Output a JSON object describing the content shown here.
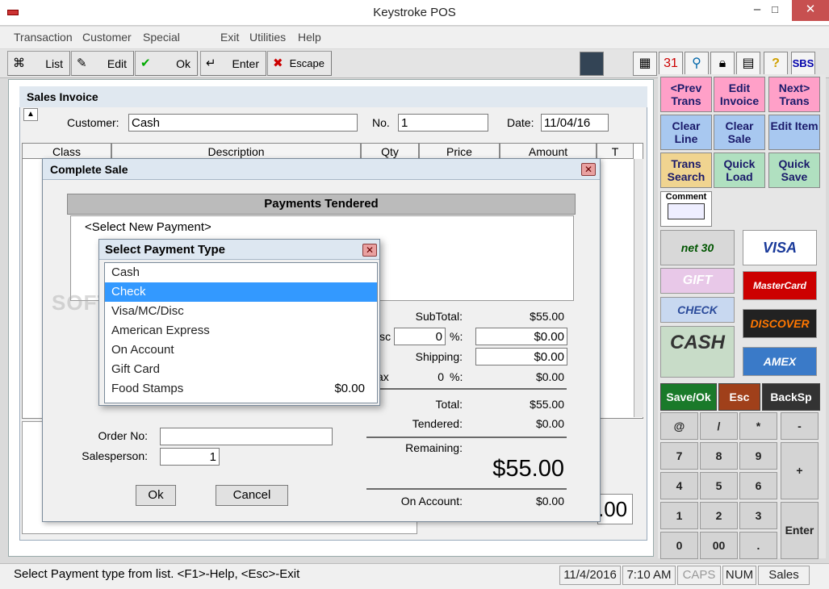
{
  "window": {
    "title": "Keystroke POS",
    "minimize": "–",
    "maximize": "□",
    "close": "✕"
  },
  "menu": [
    "Transaction",
    "Customer",
    "Special",
    "Exit",
    "Utilities",
    "Help"
  ],
  "toolbar": {
    "list": "List",
    "edit": "Edit",
    "ok": "Ok",
    "enter": "Enter",
    "escape": "Escape"
  },
  "invoice": {
    "title": "Sales Invoice",
    "customer_label": "Customer:",
    "customer_value": "Cash",
    "no_label": "No.",
    "no_value": "1",
    "date_label": "Date:",
    "date_value": "11/04/16",
    "total_fragment": ".00"
  },
  "columns": [
    "Class",
    "Description",
    "Qty",
    "Price",
    "Amount",
    "T"
  ],
  "complete_sale": {
    "title": "Complete Sale",
    "payments_header": "Payments Tendered",
    "select_new_payment": "<Select New Payment>",
    "subtotal_label": "SubTotal:",
    "subtotal_value": "$55.00",
    "disc_label": "isc",
    "disc_pct": "0",
    "pct_sign": "%:",
    "disc_amount": "$0.00",
    "shipping_label": "Shipping:",
    "shipping_value": "$0.00",
    "tax_label": "ax",
    "tax_pct": "0",
    "tax_value": "$0.00",
    "total_label": "Total:",
    "total_value": "$55.00",
    "tendered_label": "Tendered:",
    "tendered_value": "$0.00",
    "remaining_label": "Remaining:",
    "remaining_value": "$55.00",
    "on_account_label": "On Account:",
    "on_account_value": "$0.00",
    "order_no_label": "Order No:",
    "order_no_value": "",
    "salesperson_label": "Salesperson:",
    "salesperson_value": "1",
    "ok_label": "Ok",
    "cancel_label": "Cancel"
  },
  "payment_popup": {
    "title": "Select Payment Type",
    "selected_index": 1,
    "items": [
      {
        "label": "Cash",
        "amount": ""
      },
      {
        "label": "Check",
        "amount": ""
      },
      {
        "label": "Visa/MC/Disc",
        "amount": ""
      },
      {
        "label": "American Express",
        "amount": ""
      },
      {
        "label": "On Account",
        "amount": ""
      },
      {
        "label": "Gift Card",
        "amount": ""
      },
      {
        "label": "Food Stamps",
        "amount": "$0.00"
      }
    ]
  },
  "watermark": "SOFTPEDIA",
  "right_panel": {
    "buttons": [
      {
        "label": "<Prev Trans",
        "color": "#ffa0c8"
      },
      {
        "label": "Edit Invoice",
        "color": "#ffa0c8"
      },
      {
        "label": "Next> Trans",
        "color": "#ffa0c8"
      },
      {
        "label": "Clear Line",
        "color": "#a8c8f0"
      },
      {
        "label": "Clear Sale",
        "color": "#a8c8f0"
      },
      {
        "label": "Edit Item",
        "color": "#a8c8f0"
      },
      {
        "label": "Trans Search",
        "color": "#f0d490"
      },
      {
        "label": "Quick Load",
        "color": "#b0e0c0"
      },
      {
        "label": "Quick Save",
        "color": "#b0e0c0"
      }
    ],
    "comment_label": "Comment",
    "pay_icons": {
      "net30": "net 30",
      "visa": "VISA",
      "gift": "GIFT",
      "mastercard": "MasterCard",
      "check": "CHECK",
      "discover": "DISCOVER",
      "cash": "CASH",
      "amex": "AMEX"
    },
    "save_ok": "Save/Ok",
    "esc": "Esc",
    "backsp": "BackSp",
    "keypad": [
      "@",
      "/",
      "*",
      "-",
      "7",
      "8",
      "9",
      "+",
      "4",
      "5",
      "6",
      "1",
      "2",
      "3",
      "Enter",
      "0",
      "00",
      "."
    ]
  },
  "status": {
    "message": "Select Payment type from list. <F1>-Help, <Esc>-Exit",
    "date": "11/4/2016",
    "time": "7:10 AM",
    "caps": "CAPS",
    "num": "NUM",
    "mode": "Sales"
  }
}
